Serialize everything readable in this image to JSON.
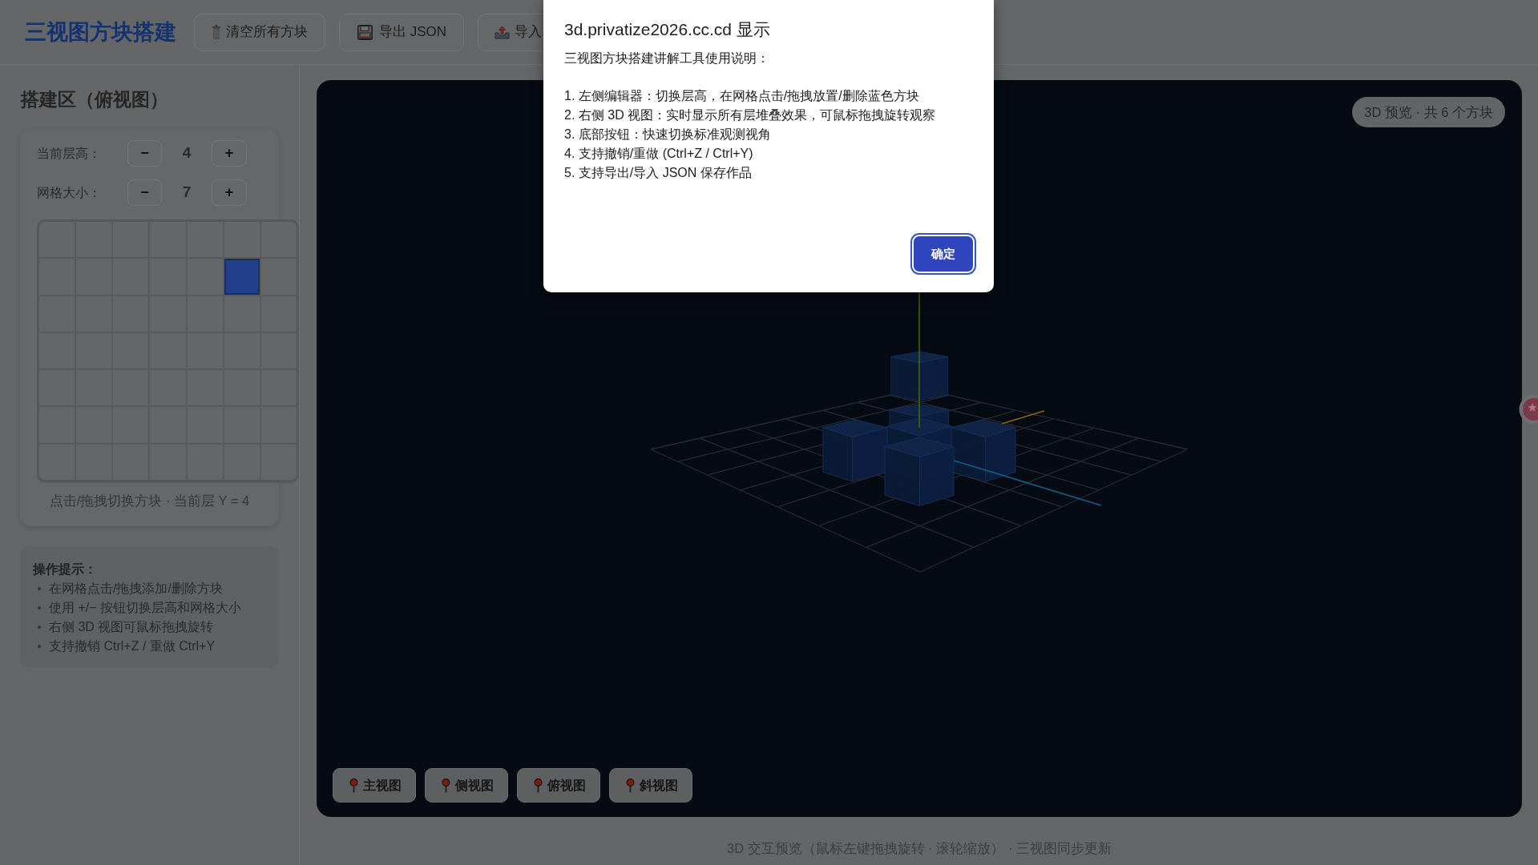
{
  "header": {
    "title": "三视图方块搭建",
    "buttons": [
      {
        "label": "清空所有方块"
      },
      {
        "label": "导出 JSON"
      },
      {
        "label": "导入"
      }
    ]
  },
  "editor": {
    "title": "搭建区（俯视图）",
    "steppers": [
      {
        "label": "当前层高：",
        "decrement": "−",
        "value": "4",
        "increment": "+"
      },
      {
        "label": "网格大小：",
        "decrement": "−",
        "value": "7",
        "increment": "+"
      }
    ],
    "grid": {
      "rows": [
        {
          "filled": [
            false,
            false,
            false,
            false,
            false,
            false,
            false
          ]
        },
        {
          "filled": [
            false,
            false,
            false,
            false,
            false,
            true,
            false
          ]
        },
        {
          "filled": [
            false,
            false,
            false,
            false,
            false,
            false,
            false
          ]
        },
        {
          "filled": [
            false,
            false,
            false,
            false,
            false,
            false,
            false
          ]
        },
        {
          "filled": [
            false,
            false,
            false,
            false,
            false,
            false,
            false
          ]
        },
        {
          "filled": [
            false,
            false,
            false,
            false,
            false,
            false,
            false
          ]
        },
        {
          "filled": [
            false,
            false,
            false,
            false,
            false,
            false,
            false
          ]
        }
      ]
    },
    "caption": "点击/拖拽切换方块 · 当前层 Y = 4"
  },
  "tips": {
    "title": "操作提示：",
    "items": [
      "在网格点击/拖拽添加/删除方块",
      "使用 +/− 按钮切换层高和网格大小",
      "右侧 3D 视图可鼠标拖拽旋转",
      "支持撤销 Ctrl+Z / 重做 Ctrl+Y"
    ]
  },
  "preview": {
    "badge": "3D 预览 · 共 6 个方块",
    "view_buttons": [
      "主视图",
      "侧视图",
      "俯视图",
      "斜视图"
    ]
  },
  "footer": "3D 交互预览（鼠标左键拖拽旋转 · 滚轮缩放） · 三视图同步更新",
  "dialog": {
    "title": "3d.privatize2026.cc.cd 显示",
    "intro": "三视图方块搭建讲解工具使用说明：",
    "items": [
      "1. 左侧编辑器：切换层高，在网格点击/拖拽放置/删除蓝色方块",
      "2. 右侧 3D 视图：实时显示所有层堆叠效果，可鼠标拖拽旋转观察",
      "3. 底部按钮：快速切换标准观测视角",
      "4. 支持撤销/重做 (Ctrl+Z / Ctrl+Y)",
      "5. 支持导出/导入 JSON 保存作品"
    ],
    "button": "确定"
  }
}
